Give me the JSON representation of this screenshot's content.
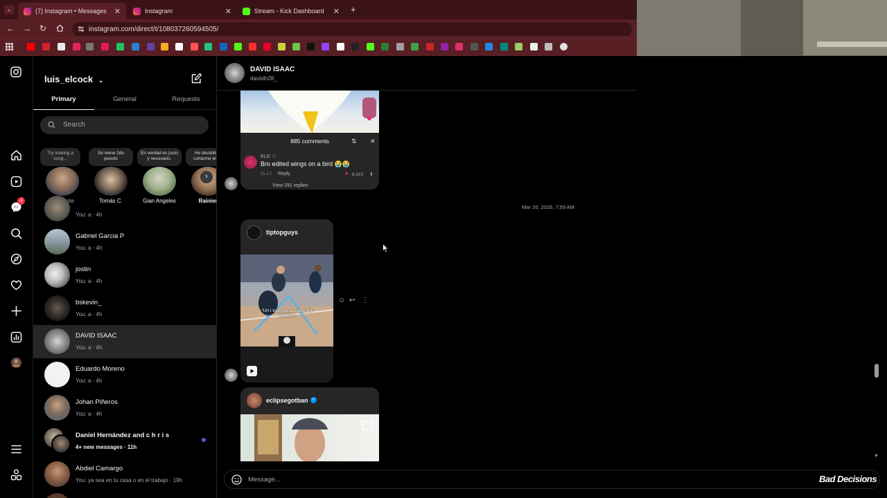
{
  "browser": {
    "tabs": [
      {
        "title": "(7) Instagram • Messages",
        "active": true,
        "favicon_color": "#e1306c"
      },
      {
        "title": "Instagram",
        "active": false,
        "favicon_color": "#e1306c"
      },
      {
        "title": "Stream - Kick Dashboard",
        "active": false,
        "favicon_color": "#53fc18"
      }
    ],
    "url": "instagram.com/direct/t/108037260594505/",
    "new_tab": "+"
  },
  "rail": {
    "notifications_badge": "4"
  },
  "inbox": {
    "username": "luis_elcock",
    "tabs": [
      "Primary",
      "General",
      "Requests"
    ],
    "active_tab": "Primary",
    "search_placeholder": "Search",
    "notes": [
      {
        "bubble": "Try sharing a song...",
        "name": "Your note"
      },
      {
        "bubble": "Se viene 2do puesto",
        "name": "Tomás C."
      },
      {
        "bubble": "En verdad es justo y necesario.",
        "name": "Gian Angeles"
      },
      {
        "bubble": "He decidido cortarme el p",
        "name": "Rainier"
      }
    ],
    "chats": [
      {
        "name": "",
        "sub": "You: a · 4h",
        "selected": false
      },
      {
        "name": "Gabriel Garcia P",
        "sub": "You: a · 4h",
        "selected": false
      },
      {
        "name": "jostin",
        "sub": "You: a · 4h",
        "selected": false
      },
      {
        "name": "bskevin_",
        "sub": "You: a · 4h",
        "selected": false
      },
      {
        "name": "DAVID ISAAC",
        "sub": "You: a · 4h",
        "selected": true
      },
      {
        "name": "Eduardo Moreno",
        "sub": "You: a · 4h",
        "selected": false
      },
      {
        "name": "Johan Piñeros",
        "sub": "You: a · 4h",
        "selected": false
      },
      {
        "name": "Daniel Hernández and c h r i s",
        "sub": "4+ new messages · 11h",
        "selected": false,
        "unread": true
      },
      {
        "name": "Abdiel Camargo",
        "sub": "You: ya sea en tu casa o en el trabajo · 19h",
        "selected": false
      }
    ]
  },
  "conversation": {
    "name": "DAVID ISAAC",
    "handle": "daviidh28_",
    "timestamp": "Mar 26, 2026, 7:59 AM",
    "comments_card": {
      "count_label": "885 comments",
      "commenter": "KLG ☆",
      "comment": "Bro edited wings on a bird 😭😭",
      "date": "11-17",
      "reply": "Reply",
      "likes": "8,310",
      "view_replies": "View 291 replies"
    },
    "post1": {
      "author": "tiptopguys",
      "caption": "\"Uh I touched a... age ahh reaction\""
    },
    "post2": {
      "author": "eclipsegotban"
    },
    "composer_placeholder": "Message..."
  },
  "watermark": "Bad Decisions",
  "colors": {
    "accent_blue": "#0095f6",
    "unread_dot": "#5851db",
    "badge_red": "#ff3040",
    "browser_bg": "#3b1317"
  }
}
